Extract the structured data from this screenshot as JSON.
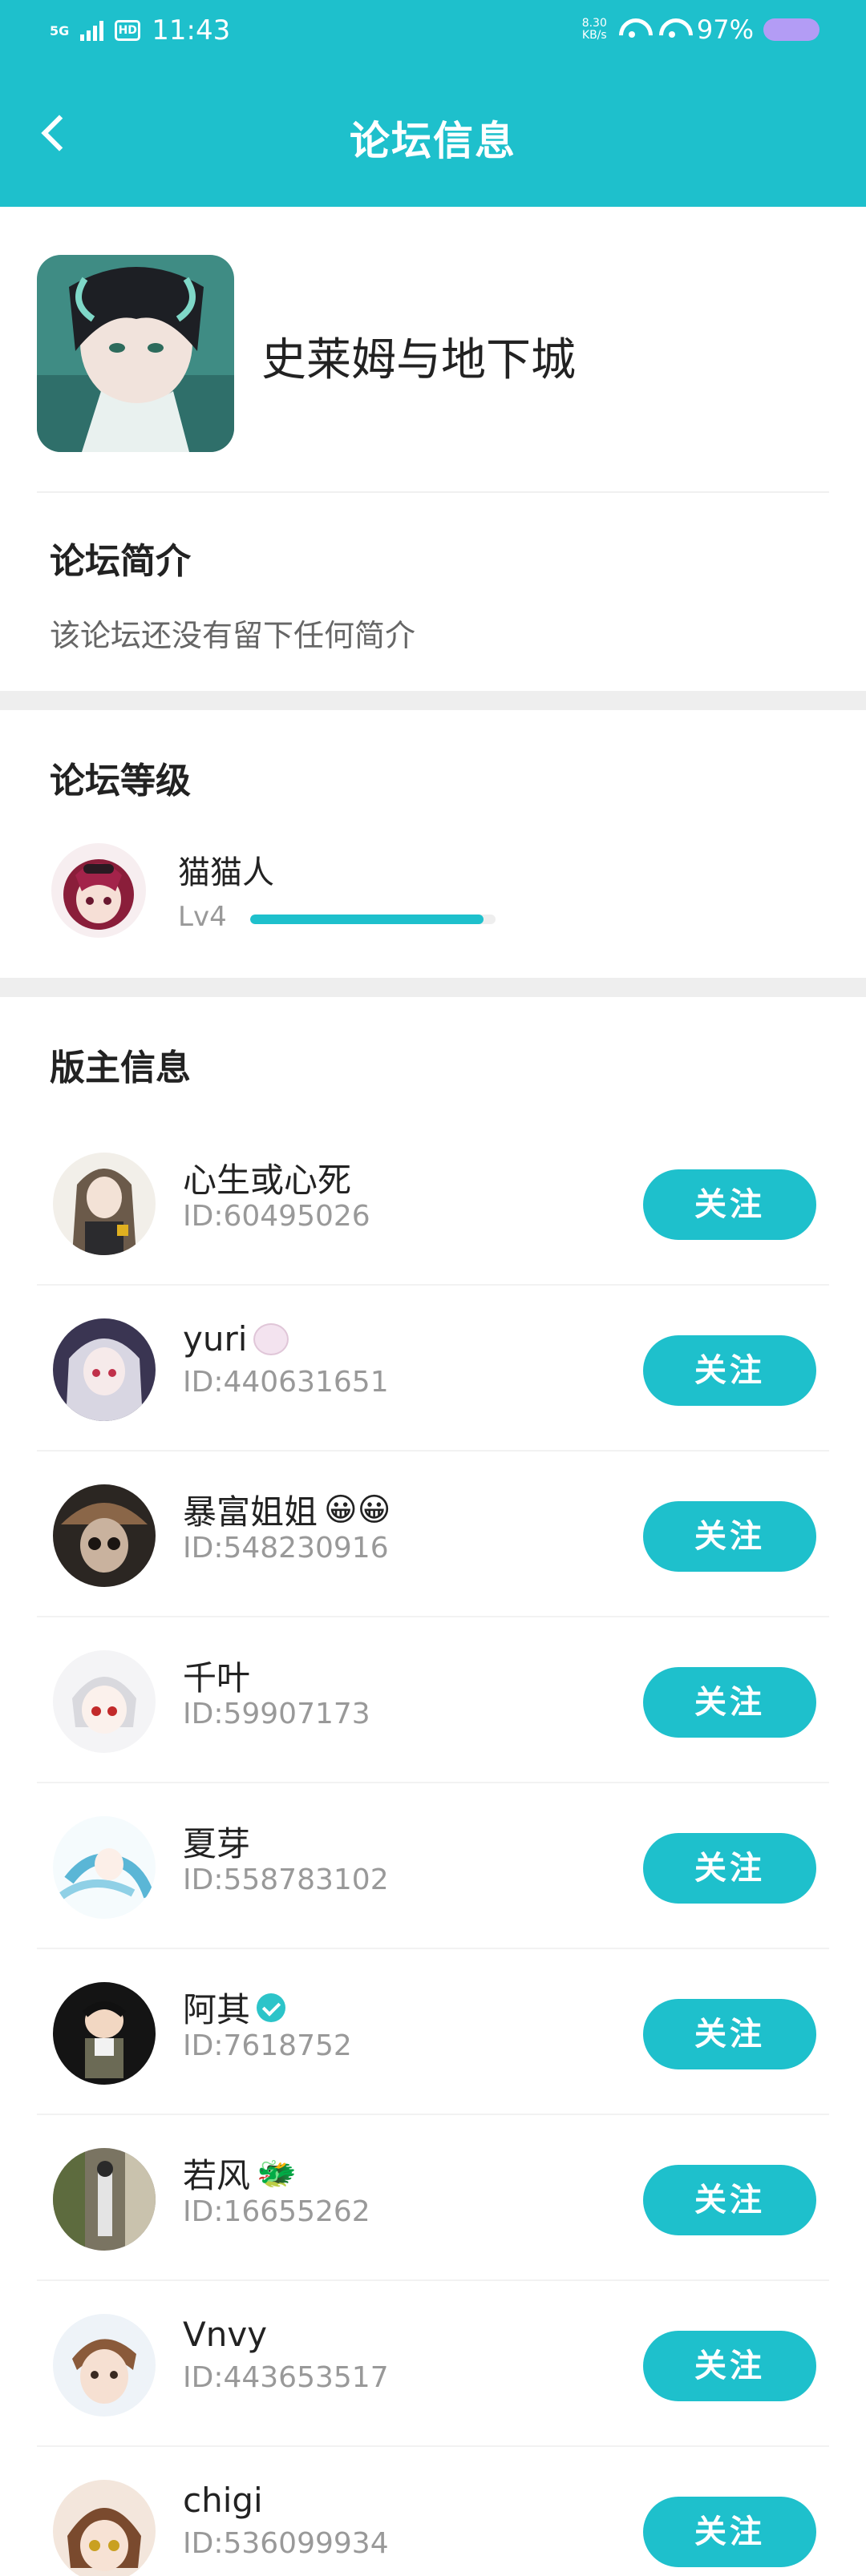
{
  "status_bar": {
    "time": "11:43",
    "network": "5G",
    "hd": "HD",
    "speed": "8.30",
    "speed_unit": "KB/s",
    "battery": "97%"
  },
  "header": {
    "title": "论坛信息",
    "back_icon": "chevron-left-icon"
  },
  "forum": {
    "name": "史莱姆与地下城",
    "intro_title": "论坛简介",
    "intro_text": "该论坛还没有留下任何简介"
  },
  "level": {
    "title": "论坛等级",
    "name": "猫猫人",
    "lv": "Lv4",
    "progress": 0.95
  },
  "moderators": {
    "title": "版主信息",
    "follow_label": "关注",
    "items": [
      {
        "name": "心生或心死",
        "id": "ID:60495026",
        "badge": ""
      },
      {
        "name": "yuri",
        "id": "ID:440631651",
        "badge": ""
      },
      {
        "name": "暴富姐姐",
        "id": "ID:548230916",
        "badge": "😀😀"
      },
      {
        "name": "千叶",
        "id": "ID:59907173",
        "badge": ""
      },
      {
        "name": "夏芽",
        "id": "ID:558783102",
        "badge": ""
      },
      {
        "name": "阿其",
        "id": "ID:7618752",
        "badge": ""
      },
      {
        "name": "若风",
        "id": "ID:16655262",
        "badge": "🐲"
      },
      {
        "name": "Vnvy",
        "id": "ID:443653517",
        "badge": ""
      },
      {
        "name": "chigi",
        "id": "ID:536099934",
        "badge": ""
      }
    ]
  },
  "colors": {
    "accent": "#1ec0cc",
    "battery": "#b39cf5"
  }
}
